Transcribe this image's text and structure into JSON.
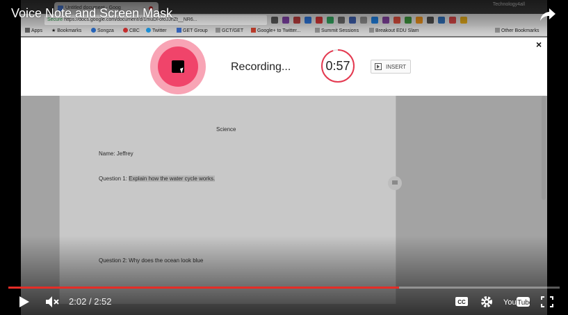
{
  "video": {
    "title": "Voice Note and Screen Mask",
    "current_time": "2:02",
    "separator": "/",
    "duration": "2:52",
    "progress_fraction": 0.7093,
    "progress_color": "#e52d27"
  },
  "browser": {
    "tab_title": "Untitled document - Goog",
    "profile": "Technology4all",
    "url_secure": "Secure",
    "url": "https://docs.google.com/document/d/1muDl-ofoJJhZt__NR6...",
    "bookmarks": [
      {
        "label": "Apps",
        "icon": "apps-grid-icon"
      },
      {
        "label": "Bookmarks",
        "icon": "star-icon"
      },
      {
        "label": "Songza",
        "icon": "songza-icon"
      },
      {
        "label": "CBC",
        "icon": "cbc-icon"
      },
      {
        "label": "Twitter",
        "icon": "twitter-icon"
      },
      {
        "label": "GET Group",
        "icon": "group-icon"
      },
      {
        "label": "GCT/GET",
        "icon": "folder-icon"
      },
      {
        "label": "Google+ to Twitter...",
        "icon": "google-plus-icon"
      },
      {
        "label": "Summit Sessions",
        "icon": "folder-icon"
      },
      {
        "label": "Breakout EDU Slam",
        "icon": "folder-icon"
      }
    ],
    "other_bookmarks": "Other Bookmarks"
  },
  "recorder": {
    "status": "Recording...",
    "timer": "0:57",
    "timer_remaining_fraction": 0.95,
    "insert_label": "INSERT",
    "close_label": "×",
    "accent": "#f0446a"
  },
  "document": {
    "heading": "Science",
    "name_line": "Name: Jeffrey",
    "q1_prefix": "Question 1: ",
    "q1_highlight": "Explain how the water cycle works.",
    "q2": "Question 2: Why does the ocean look blue"
  }
}
